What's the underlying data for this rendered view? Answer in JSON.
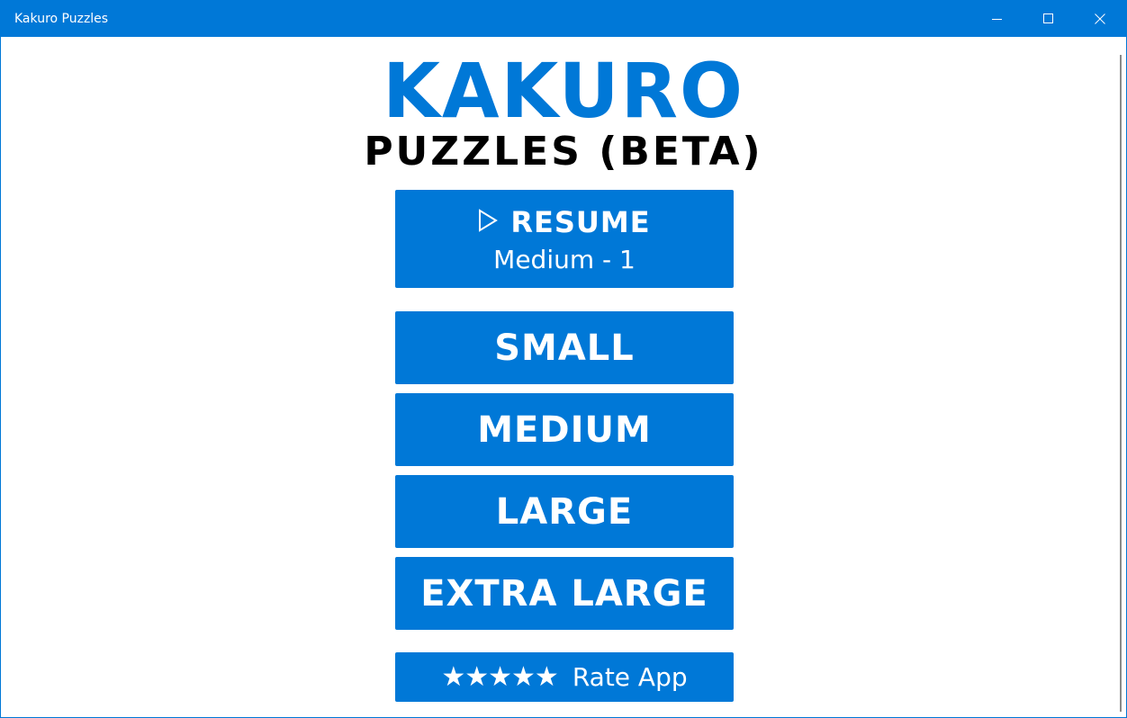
{
  "window": {
    "title": "Kakuro Puzzles",
    "accent_color": "#0078d7",
    "caption_buttons": [
      "minimize-icon",
      "maximize-icon",
      "close-icon"
    ]
  },
  "logo": {
    "main": "KAKURO",
    "sub": "PUZZLES (BETA)",
    "main_color": "#0078d7",
    "sub_color": "#000000"
  },
  "resume": {
    "icon": "play-icon",
    "label": "RESUME",
    "detail": "Medium - 1"
  },
  "sizes": {
    "small": "SMALL",
    "medium": "MEDIUM",
    "large": "LARGE",
    "extra_large": "EXTRA LARGE"
  },
  "rate": {
    "stars": "★★★★★",
    "label": "Rate App"
  }
}
